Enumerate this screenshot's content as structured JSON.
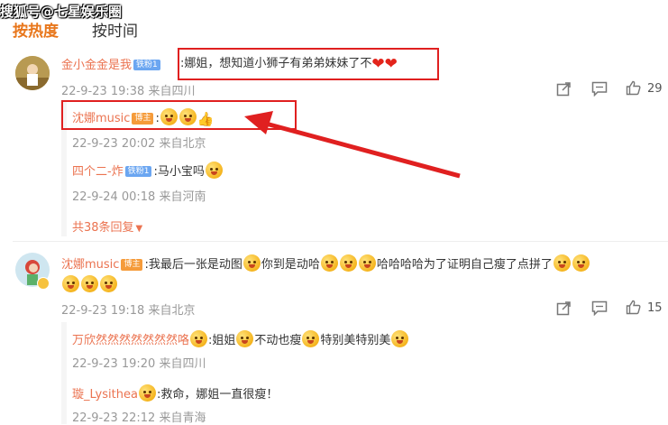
{
  "watermark": "搜狐号@七星娱乐圈",
  "tabs": {
    "hot": "按热度",
    "time": "按时间"
  },
  "comment1": {
    "user": "金小金金是我",
    "fan_badge": "铁粉1",
    "text": ":娜姐，想知道小狮子有弟弟妹妹了不",
    "meta": "22-9-23 19:38 来自四川",
    "likes": "29",
    "replies": [
      {
        "user": "沈娜music",
        "host_badge": "博主",
        "text": ":",
        "meta": "22-9-23 20:02 来自北京"
      },
      {
        "user": "四个二-炸",
        "fan_badge": "铁粉1",
        "text": ":马小宝吗",
        "meta": "22-9-24 00:18 来自河南"
      }
    ],
    "more": "共38条回复"
  },
  "comment2": {
    "user": "沈娜music",
    "host_badge": "博主",
    "text_a": ":我最后一张是动图",
    "text_b": "你到是动哈",
    "text_c": "哈哈哈哈为了证明自己瘦了点拼了",
    "meta": "22-9-23 19:18 来自北京",
    "likes": "15",
    "replies": [
      {
        "user": "万欣然然然然然然然咯",
        "text_a": ":姐姐",
        "text_b": "不动也瘦",
        "text_c": "特别美特别美",
        "meta": "22-9-23 19:20 来自四川"
      },
      {
        "user": "璇_Lysithea",
        "text": ":救命，娜姐一直很瘦！",
        "meta": "22-9-23 22:12 来自青海"
      }
    ]
  },
  "colors": {
    "accent": "#eb7350",
    "annotation": "#e02020",
    "tab_active": "#e8761b"
  },
  "icons": [
    "share-icon",
    "comment-icon",
    "like-icon",
    "verified-icon",
    "thumbs-up-emoji"
  ]
}
